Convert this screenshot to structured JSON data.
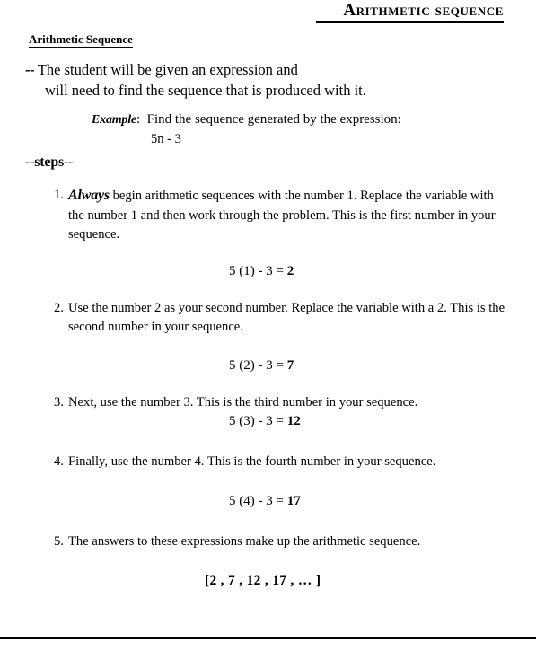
{
  "header": {
    "title": "Arithmetic Sequence"
  },
  "sub_heading": "Arithmetic Sequence",
  "intro": {
    "dashes": "--",
    "line1": " The student will be given an expression and",
    "line2": "will need to find the sequence that is produced with it."
  },
  "example": {
    "label": "Example",
    "label_colon": ":",
    "prompt": "Find the sequence generated by the expression:",
    "expression": "5n - 3"
  },
  "steps_marker": "--steps--",
  "steps": [
    {
      "number": "1.",
      "emphasis": "Always",
      "text": " begin arithmetic sequences with the number 1. Replace the variable with the number 1 and then work through the problem.  This is the first number in your sequence."
    },
    {
      "number": "2.",
      "emphasis": "",
      "text": " Use the number 2 as your second number.  Replace the variable with a 2.  This is the second number in your sequence."
    },
    {
      "number": "3.",
      "emphasis": "",
      "text": " Next, use the number 3. This is the third number in your sequence."
    },
    {
      "number": "4.",
      "emphasis": "",
      "text": " Finally, use the number 4. This is the fourth number in your sequence."
    },
    {
      "number": "5.",
      "emphasis": "",
      "text": " The answers to these expressions make up the arithmetic sequence."
    }
  ],
  "equations": [
    {
      "expression": "5 (1) - 3 = ",
      "answer": "2"
    },
    {
      "expression": "5 (2) - 3 = ",
      "answer": "7"
    },
    {
      "expression": "5 (3) - 3 = ",
      "answer": "12"
    },
    {
      "expression": "5 (4) - 3 = ",
      "answer": "17"
    }
  ],
  "final_answer": "[2 , 7 , 12 , 17 , … ]",
  "colors": {
    "text": "#000000",
    "background": "#ffffff",
    "rule": "#000000"
  }
}
